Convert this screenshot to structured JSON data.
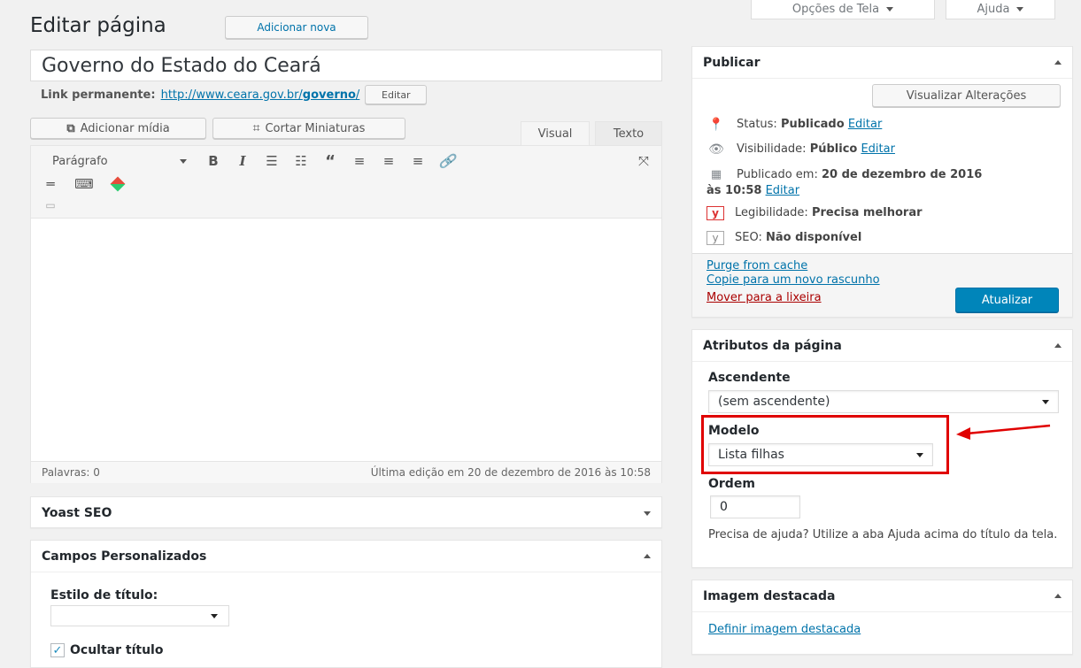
{
  "screen_options": "Opções de Tela",
  "help": "Ajuda",
  "page_title": "Editar página",
  "add_new": "Adicionar nova",
  "post_title": "Governo do Estado do Ceará",
  "permalink": {
    "label": "Link permanente:",
    "url_base": "http://www.ceara.gov.br/",
    "url_slug": "governo",
    "url_end": "/",
    "edit": "Editar"
  },
  "media": {
    "add_media": "Adicionar mídia",
    "crop_thumbs": "Cortar Miniaturas"
  },
  "editor_tabs": {
    "visual": "Visual",
    "text": "Texto"
  },
  "toolbar": {
    "format": "Parágrafo",
    "bold": "B",
    "italic": "I"
  },
  "status_bar": {
    "words": "Palavras: 0",
    "last_edit": "Última edição em 20 de dezembro de 2016 às 10:58"
  },
  "yoast_box": {
    "title": "Yoast SEO"
  },
  "custom_fields": {
    "title": "Campos Personalizados",
    "style_label": "Estilo de título:",
    "style_value": "",
    "hide_title": "Ocultar título"
  },
  "publish": {
    "title": "Publicar",
    "preview": "Visualizar Alterações",
    "status_label": "Status:",
    "status_value": "Publicado",
    "status_edit": "Editar",
    "visibility_label": "Visibilidade:",
    "visibility_value": "Público",
    "visibility_edit": "Editar",
    "published_label": "Publicado em:",
    "published_value": "20 de dezembro de 2016",
    "published_time": "às 10:58",
    "published_edit": "Editar",
    "readability_label": "Legibilidade:",
    "readability_value": "Precisa melhorar",
    "seo_label": "SEO:",
    "seo_value": "Não disponível",
    "purge": "Purge from cache",
    "copy_draft": "Copie para um novo rascunho",
    "trash": "Mover para a lixeira",
    "update": "Atualizar"
  },
  "attributes": {
    "title": "Atributos da página",
    "parent_label": "Ascendente",
    "parent_value": "(sem ascendente)",
    "template_label": "Modelo",
    "template_value": "Lista filhas",
    "order_label": "Ordem",
    "order_value": "0",
    "help_text": "Precisa de ajuda? Utilize a aba Ajuda acima do título da tela."
  },
  "featured": {
    "title": "Imagem destacada",
    "set_link": "Definir imagem destacada"
  },
  "colors": {
    "primary": "#0085ba",
    "highlight": "#e00000",
    "trash": "#a00",
    "yoast_red": "#dc3232"
  }
}
